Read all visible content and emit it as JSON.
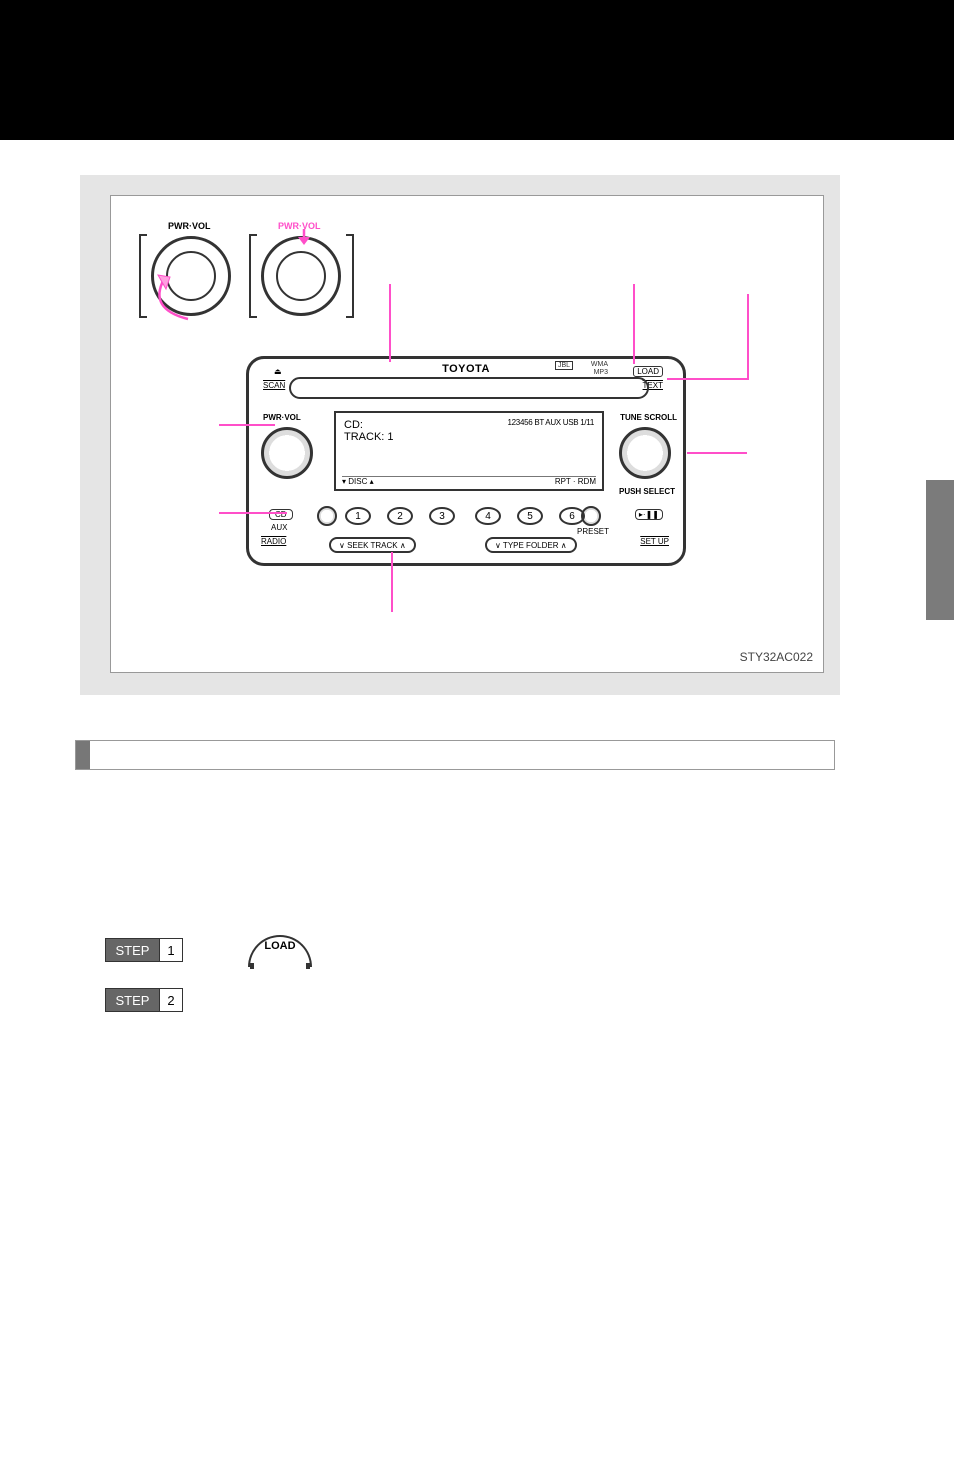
{
  "headunit": {
    "brand": "TOYOTA",
    "sideLogos": {
      "jbl": "JBL",
      "wma": "WMA",
      "mp3": "MP3"
    },
    "knobLabels": {
      "pwrVol": "PWR·VOL",
      "tuneScroll": "TUNE SCROLL",
      "pushSelect": "PUSH SELECT"
    },
    "topButtons": {
      "eject": "⏏",
      "load": "LOAD",
      "text": "TEXT",
      "scan": "SCAN"
    },
    "lcd": {
      "line1": "CD:",
      "line2": "TRACK: 1",
      "rightIcons": "123456  BT  AUX USB  1/11",
      "bottom": {
        "left": "▾  DISC  ▴",
        "right": "RPT   ·   RDM"
      }
    },
    "presets": [
      "1",
      "2",
      "3",
      "4",
      "5",
      "6"
    ],
    "smallKnobs": {
      "left": "",
      "right": "PRESET"
    },
    "sideButtons": {
      "cd": "CD",
      "aux": "AUX",
      "radio": "RADIO",
      "playPause": "▸·❚❚",
      "setup": "SET UP"
    },
    "barButtons": {
      "seekTrack": "∨   SEEK TRACK   ∧",
      "typeFolder": "∨  TYPE FOLDER  ∧"
    }
  },
  "figureCode": "STY32AC022",
  "steps": {
    "label": "STEP",
    "s1": "1",
    "s2": "2"
  },
  "loadButtonLabel": "LOAD"
}
